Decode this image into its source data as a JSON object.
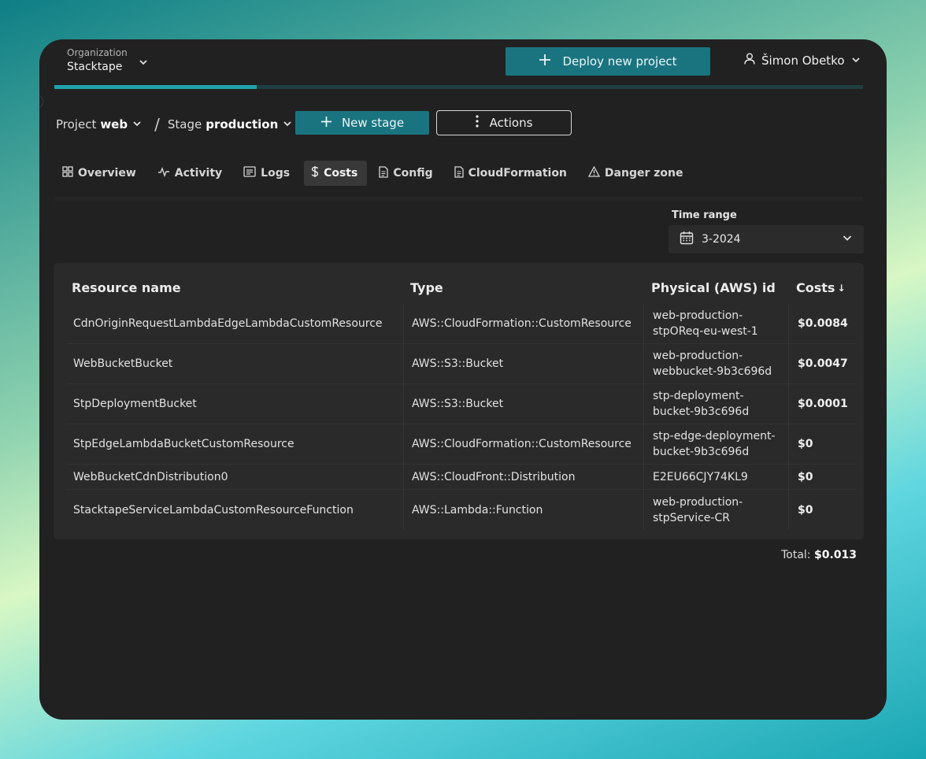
{
  "header": {
    "org_label": "Organization",
    "org_name": "Stacktape",
    "deploy_label": "Deploy new project",
    "user_name": "Šimon Obetko",
    "progress_fraction": 0.25
  },
  "breadcrumb": {
    "project_prefix": "Project",
    "project_name": "web",
    "separator": "/",
    "stage_prefix": "Stage",
    "stage_name": "production",
    "new_stage_label": "New stage",
    "actions_label": "Actions"
  },
  "tabs": [
    {
      "label": "Overview",
      "icon": "grid-icon",
      "active": false
    },
    {
      "label": "Activity",
      "icon": "activity-icon",
      "active": false
    },
    {
      "label": "Logs",
      "icon": "logs-icon",
      "active": false
    },
    {
      "label": "Costs",
      "icon": "dollar-icon",
      "active": true
    },
    {
      "label": "Config",
      "icon": "document-icon",
      "active": false
    },
    {
      "label": "CloudFormation",
      "icon": "document-icon",
      "active": false
    },
    {
      "label": "Danger zone",
      "icon": "warning-icon",
      "active": false
    }
  ],
  "time_range": {
    "label": "Time range",
    "value": "3-2024"
  },
  "table": {
    "columns": [
      "Resource name",
      "Type",
      "Physical (AWS) id",
      "Costs"
    ],
    "sort_indicator": "↓",
    "rows": [
      {
        "name": "CdnOriginRequestLambdaEdgeLambdaCustomResource",
        "type": "AWS::CloudFormation::CustomResource",
        "id_line1": "web-production-",
        "id_line2": "stpOReq-eu-west-1",
        "cost": "$0.0084"
      },
      {
        "name": "WebBucketBucket",
        "type": "AWS::S3::Bucket",
        "id_line1": "web-production-",
        "id_line2": "webbucket-9b3c696d",
        "cost": "$0.0047"
      },
      {
        "name": "StpDeploymentBucket",
        "type": "AWS::S3::Bucket",
        "id_line1": "stp-deployment-",
        "id_line2": "bucket-9b3c696d",
        "cost": "$0.0001"
      },
      {
        "name": "StpEdgeLambdaBucketCustomResource",
        "type": "AWS::CloudFormation::CustomResource",
        "id_line1": "stp-edge-deployment-",
        "id_line2": "bucket-9b3c696d",
        "cost": "$0"
      },
      {
        "name": "WebBucketCdnDistribution0",
        "type": "AWS::CloudFront::Distribution",
        "id_line1": "E2EU66CJY74KL9",
        "id_line2": "",
        "cost": "$0"
      },
      {
        "name": "StacktapeServiceLambdaCustomResourceFunction",
        "type": "AWS::Lambda::Function",
        "id_line1": "web-production-",
        "id_line2": "stpService-CR",
        "cost": "$0"
      }
    ]
  },
  "total": {
    "label": "Total:",
    "value": "$0.013"
  }
}
